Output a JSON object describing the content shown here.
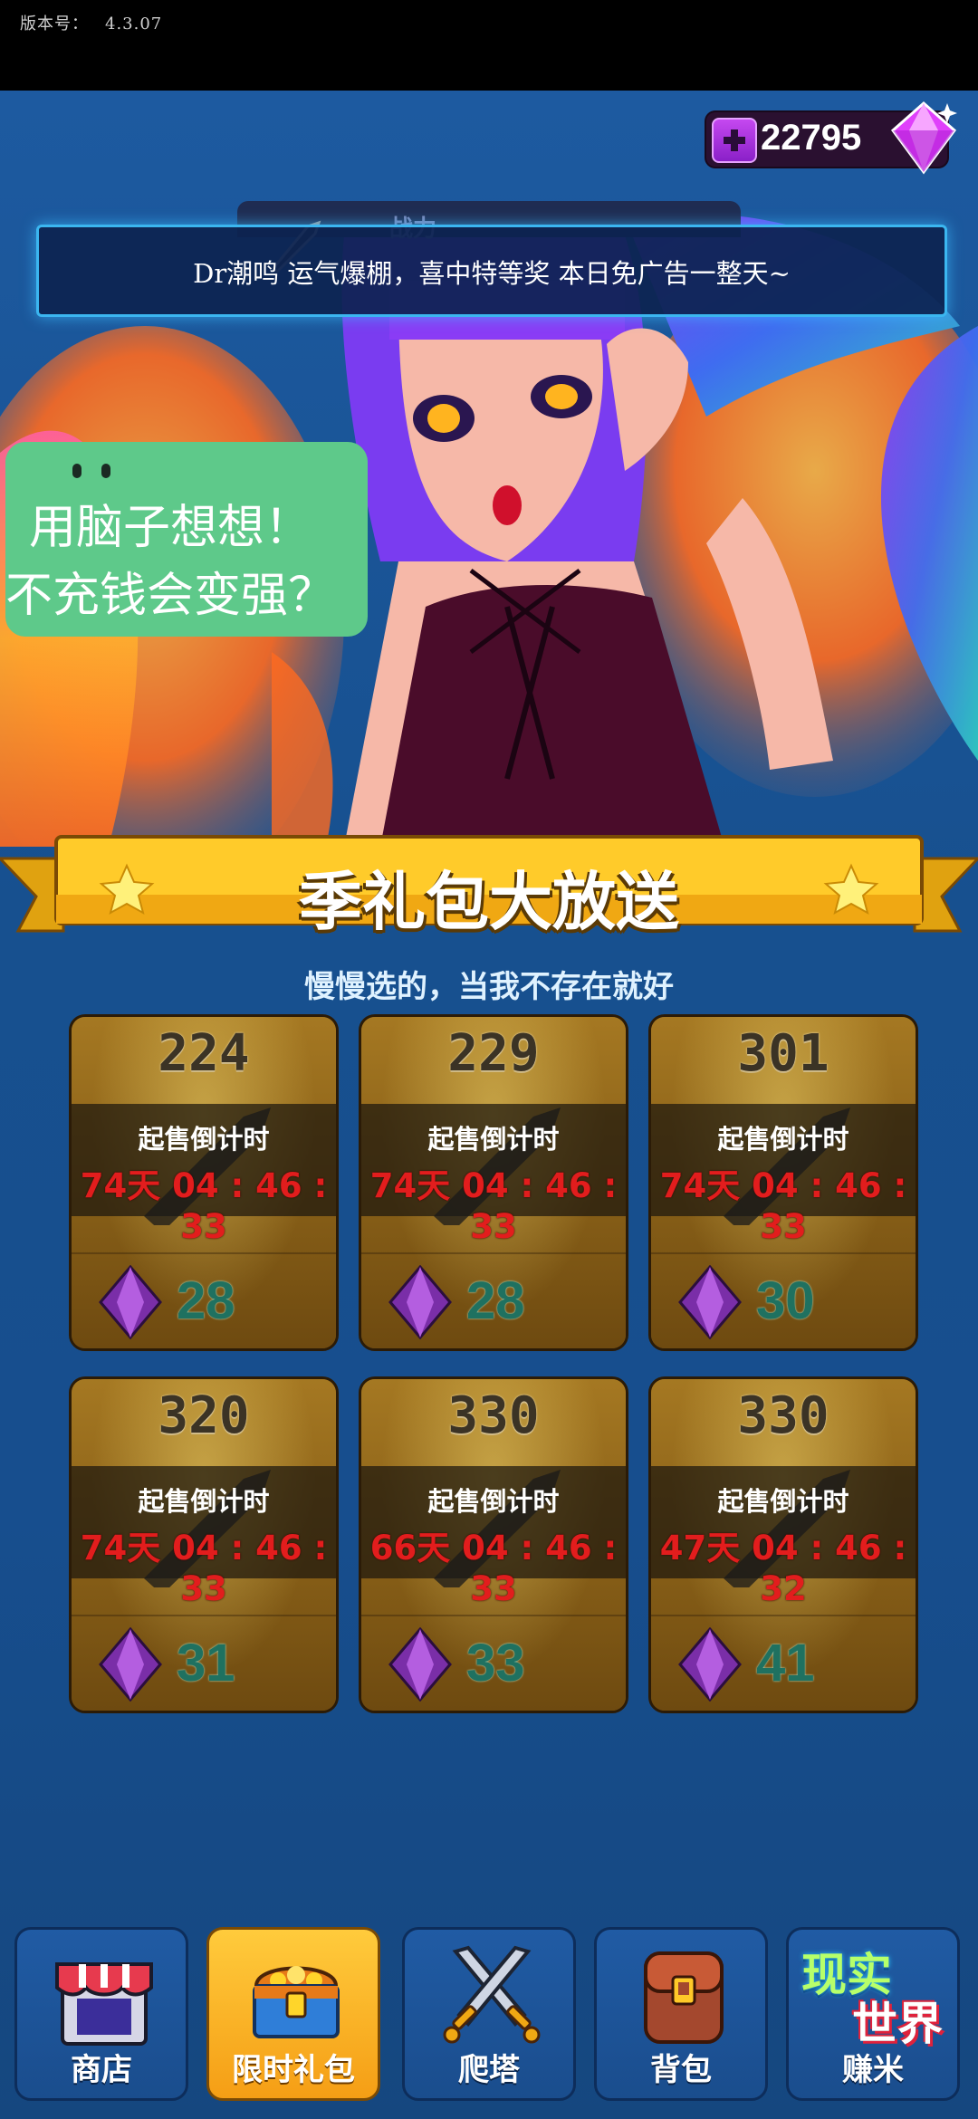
{
  "status": {
    "version_label": "版本号：",
    "version": "4.3.07"
  },
  "currency": {
    "gems": "22795"
  },
  "hero": {
    "power_label": "战力"
  },
  "notice": {
    "text": "Dr潮鸣 运气爆棚，喜中特等奖 本日免广告一整天~"
  },
  "bubble": {
    "line1": "用脑子想想！",
    "line2": "不充钱会变强？"
  },
  "banner": {
    "title": "季礼包大放送",
    "subtitle": "慢慢选的，当我不存在就好"
  },
  "packs": [
    {
      "number": "224",
      "label": "起售倒计时",
      "countdown": "74天 04 : 46 : 33",
      "price": "28"
    },
    {
      "number": "229",
      "label": "起售倒计时",
      "countdown": "74天 04 : 46 : 33",
      "price": "28"
    },
    {
      "number": "301",
      "label": "起售倒计时",
      "countdown": "74天 04 : 46 : 33",
      "price": "30"
    },
    {
      "number": "320",
      "label": "起售倒计时",
      "countdown": "74天 04 : 46 : 33",
      "price": "31"
    },
    {
      "number": "330",
      "label": "起售倒计时",
      "countdown": "66天 04 : 46 : 33",
      "price": "33"
    },
    {
      "number": "330",
      "label": "起售倒计时",
      "countdown": "47天 04 : 46 : 32",
      "price": "41"
    }
  ],
  "nav": [
    {
      "label": "商店",
      "icon": "shop-icon"
    },
    {
      "label": "限时礼包",
      "icon": "treasure-chest-icon",
      "active": true
    },
    {
      "label": "爬塔",
      "icon": "crossed-swords-icon"
    },
    {
      "label": "背包",
      "icon": "backpack-icon"
    },
    {
      "label": "赚米",
      "icon": "real-world-icon",
      "badge_line1": "现实",
      "badge_line2": "世界"
    }
  ],
  "colors": {
    "background": "#1a5396",
    "accent_gold": "#ffc928",
    "countdown_red": "#e21d1d",
    "price_teal": "#1f7160"
  }
}
